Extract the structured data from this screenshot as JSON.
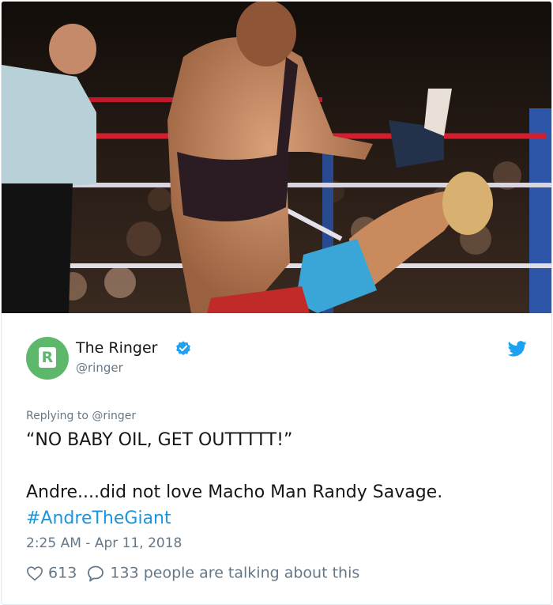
{
  "tweet": {
    "author_name": "The Ringer",
    "author_handle": "@ringer",
    "avatar_letter": "R",
    "replying_to": "Replying to @ringer",
    "line1": "“NO BABY OIL, GET OUTTTTT!”",
    "line2": "Andre....did not love Macho Man Randy Savage.",
    "hashtag": "#AndreTheGiant",
    "timestamp": "2:25 AM - Apr 11, 2018",
    "likes": "613",
    "replies": "133",
    "talking_text": "people are talking about this"
  },
  "icons": {
    "verified": "verified-badge-icon",
    "brand": "twitter-bird-icon",
    "like": "heart-icon",
    "reply": "comment-bubble-icon"
  },
  "colors": {
    "avatar_bg": "#5db86c",
    "verified": "#1da1f2",
    "hashtag": "#1b95e0",
    "muted": "#657786",
    "text": "#14171a"
  }
}
